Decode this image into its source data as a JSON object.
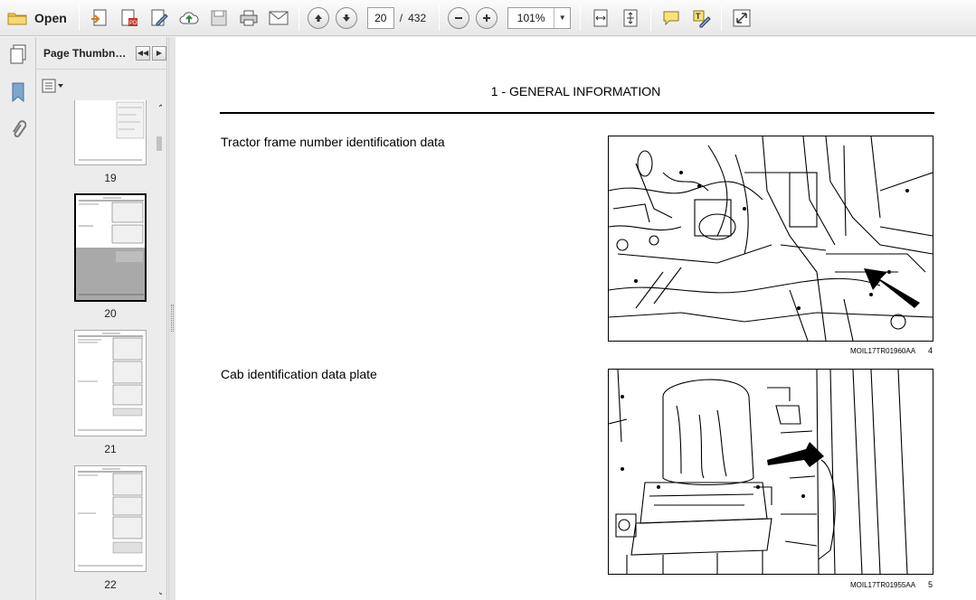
{
  "toolbar": {
    "open_label": "Open",
    "current_page": "20",
    "page_separator": "/",
    "total_pages": "432",
    "zoom": "101%",
    "icons": [
      "folder-icon",
      "create-pdf-icon",
      "export-pdf-icon",
      "edit-icon",
      "upload-icon",
      "save-icon",
      "print-icon",
      "email-icon",
      "page-up-icon",
      "page-down-icon",
      "zoom-out-icon",
      "zoom-in-icon",
      "fit-width-icon",
      "fit-page-icon",
      "comment-icon",
      "highlight-icon",
      "fullscreen-icon"
    ]
  },
  "rail": {
    "icons": [
      "pages-icon",
      "bookmark-icon",
      "attachment-icon"
    ]
  },
  "thumbnails": {
    "title": "Page Thumbnails",
    "pages": [
      {
        "label": "19"
      },
      {
        "label": "20",
        "selected": true
      },
      {
        "label": "21"
      },
      {
        "label": "22"
      }
    ]
  },
  "document": {
    "section_title": "1 - GENERAL INFORMATION",
    "figures": [
      {
        "caption": "Tractor frame number identification data",
        "ref": "MOIL17TR01960AA",
        "number": "4"
      },
      {
        "caption": "Cab identification data plate",
        "ref": "MOIL17TR01955AA",
        "number": "5"
      }
    ]
  }
}
